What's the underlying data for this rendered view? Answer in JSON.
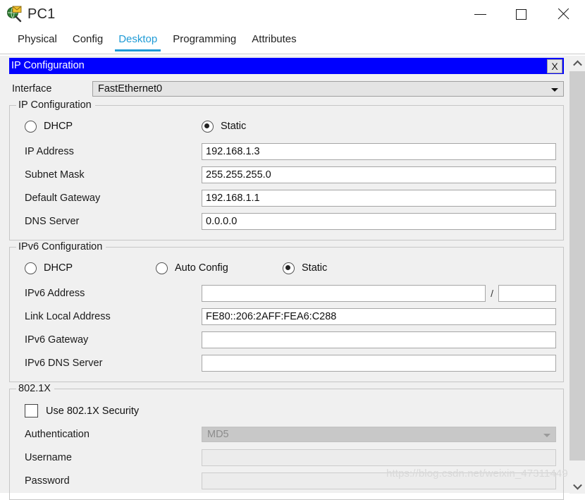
{
  "window": {
    "title": "PC1",
    "icon": "pc-network-icon",
    "minimize_label": "—",
    "maximize_label": "☐",
    "close_label": "✕"
  },
  "tabs": [
    {
      "label": "Physical",
      "active": false
    },
    {
      "label": "Config",
      "active": false
    },
    {
      "label": "Desktop",
      "active": true
    },
    {
      "label": "Programming",
      "active": false
    },
    {
      "label": "Attributes",
      "active": false
    }
  ],
  "dialog": {
    "title": "IP Configuration",
    "close_label": "X"
  },
  "interface": {
    "label": "Interface",
    "value": "FastEthernet0",
    "options": [
      "FastEthernet0"
    ]
  },
  "ip_config": {
    "legend": "IP Configuration",
    "mode_options": [
      {
        "label": "DHCP",
        "selected": false
      },
      {
        "label": "Static",
        "selected": true
      }
    ],
    "fields": [
      {
        "label": "IP Address",
        "value": "192.168.1.3",
        "placeholder": ""
      },
      {
        "label": "Subnet Mask",
        "value": "255.255.255.0",
        "placeholder": ""
      },
      {
        "label": "Default Gateway",
        "value": "192.168.1.1",
        "placeholder": ""
      },
      {
        "label": "DNS Server",
        "value": "0.0.0.0",
        "placeholder": ""
      }
    ]
  },
  "ipv6_config": {
    "legend": "IPv6 Configuration",
    "mode_options": [
      {
        "label": "DHCP",
        "selected": false
      },
      {
        "label": "Auto Config",
        "selected": false
      },
      {
        "label": "Static",
        "selected": true
      }
    ],
    "address_label": "IPv6 Address",
    "address_value": "",
    "prefix_separator": "/",
    "prefix_value": "",
    "fields": [
      {
        "label": "Link Local Address",
        "value": "FE80::206:2AFF:FEA6:C288"
      },
      {
        "label": "IPv6 Gateway",
        "value": ""
      },
      {
        "label": "IPv6 DNS Server",
        "value": ""
      }
    ]
  },
  "dot1x": {
    "legend": "802.1X",
    "checkbox_label": "Use 802.1X Security",
    "checkbox_checked": false,
    "authentication_label": "Authentication",
    "authentication_value": "MD5",
    "authentication_options": [
      "MD5"
    ],
    "username_label": "Username",
    "username_value": "",
    "password_label": "Password",
    "password_value": ""
  },
  "scrollbar": {
    "up_arrow": "chevron-up",
    "down_arrow": "chevron-down"
  },
  "watermark": {
    "text": "https://blog.csdn.net/weixin_47311449"
  },
  "colors": {
    "accent": "#1f9bd6",
    "dialog_title_bg": "#0000ff",
    "page_bg": "#f0f0f0"
  }
}
